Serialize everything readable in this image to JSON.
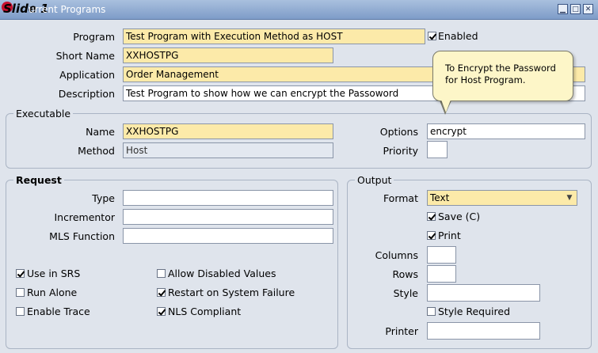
{
  "window": {
    "slide_label": "Slide 1",
    "title": "urrent Programs"
  },
  "program": {
    "program_label": "Program",
    "program_value": "Test Program with Execution Method as HOST",
    "enabled_label": "Enabled",
    "enabled_checked": true,
    "short_name_label": "Short Name",
    "short_name_value": "XXHOSTPG",
    "application_label": "Application",
    "application_value": "Order Management",
    "description_label": "Description",
    "description_value": "Test Program to show how we can encrypt the Passoword"
  },
  "tooltip": {
    "text": "To Encrypt the Password for Host Program."
  },
  "executable": {
    "group_title": "Executable",
    "name_label": "Name",
    "name_value": "XXHOSTPG",
    "options_label": "Options",
    "options_value": "encrypt",
    "method_label": "Method",
    "method_value": "Host",
    "priority_label": "Priority",
    "priority_value": ""
  },
  "request": {
    "group_title": "Request",
    "type_label": "Type",
    "incrementor_label": "Incrementor",
    "mls_label": "MLS Function",
    "use_in_srs": "Use in SRS",
    "run_alone": "Run Alone",
    "enable_trace": "Enable Trace",
    "allow_disabled": "Allow Disabled Values",
    "restart_on_failure": "Restart on System Failure",
    "nls_compliant": "NLS Compliant"
  },
  "output": {
    "group_title": "Output",
    "format_label": "Format",
    "format_value": "Text",
    "save_label": "Save (C)",
    "print_label": "Print",
    "columns_label": "Columns",
    "rows_label": "Rows",
    "style_label": "Style",
    "style_required_label": "Style Required",
    "printer_label": "Printer"
  },
  "colors": {
    "required_field": "#fceaa9",
    "titlebar": "#7e9cc8",
    "tooltip": "#fdf6c8"
  }
}
